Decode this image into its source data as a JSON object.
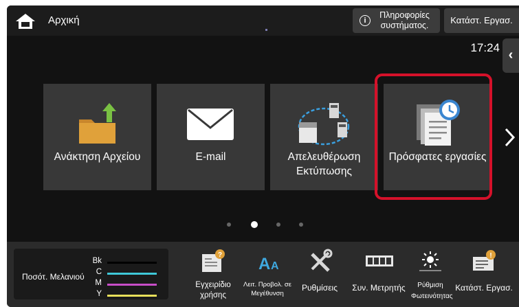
{
  "header": {
    "breadcrumb": "Αρχική",
    "info_button": "Πληροφορίες συστήματος.",
    "status_button": "Κατάστ. Εργασ.",
    "clock": "17:24"
  },
  "tiles": [
    {
      "label": "Ανάκτηση Αρχείου",
      "icon": "folder-retrieve-icon"
    },
    {
      "label": "E-mail",
      "icon": "envelope-icon"
    },
    {
      "label": "Απελευθέρωση Εκτύπωσης",
      "icon": "print-release-icon"
    },
    {
      "label": "Πρόσφατες εργασίες",
      "icon": "recent-jobs-icon",
      "highlighted": true
    }
  ],
  "pager": {
    "pages": 4,
    "current": 2
  },
  "ink": {
    "title": "Ποσότ. Μελανιού",
    "channels": [
      {
        "label": "Bk",
        "color": "#000000"
      },
      {
        "label": "C",
        "color": "#3fc8d8"
      },
      {
        "label": "M",
        "color": "#c84ec8"
      },
      {
        "label": "Y",
        "color": "#e8e05a"
      }
    ]
  },
  "shortcuts": [
    {
      "label": "Εγχειρίδιο χρήσης",
      "icon": "manual-icon"
    },
    {
      "label": "Λειτ. Προβολ. σε Μεγέθυνση",
      "icon": "zoom-text-icon"
    },
    {
      "label": "Ρυθμίσεις",
      "icon": "tools-icon"
    },
    {
      "label": "Συν. Μετρητής",
      "icon": "counter-icon"
    },
    {
      "label": "Ρύθμιση Φωτεινότητας",
      "icon": "brightness-icon"
    },
    {
      "label": "Κατάστ. Εργασ.",
      "icon": "job-status-icon"
    }
  ],
  "colors": {
    "accent_highlight": "#d5112a",
    "folder": "#e0a13a",
    "arrow_green": "#7ac143"
  }
}
